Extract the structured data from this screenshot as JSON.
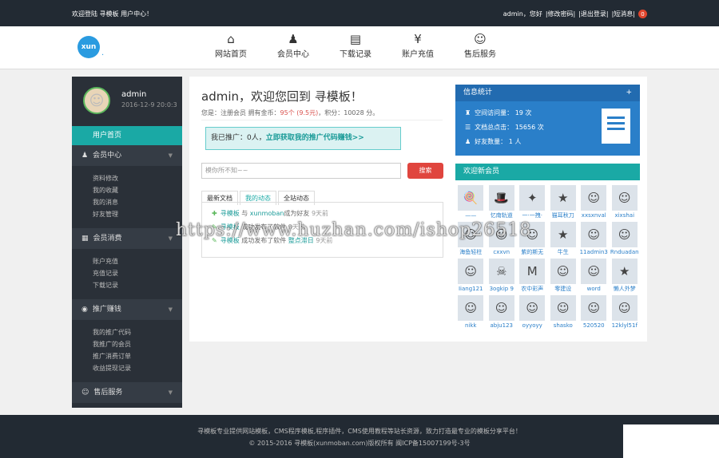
{
  "topbar": {
    "welcome": "欢迎登陆 寻模板 用户中心！",
    "greeting": "admin，您好",
    "edit_password": "|修改密码|",
    "logout": "|退出登录|",
    "messages": "|短消息|",
    "message_count": "0"
  },
  "header": {
    "logo_text": "xun",
    "nav": [
      {
        "label": "网站首页",
        "icon": "home-icon",
        "glyph": "⌂"
      },
      {
        "label": "会员中心",
        "icon": "user-icon",
        "glyph": "♟"
      },
      {
        "label": "下载记录",
        "icon": "list-icon",
        "glyph": "▤"
      },
      {
        "label": "账户充值",
        "icon": "yen-icon",
        "glyph": "¥"
      },
      {
        "label": "售后服务",
        "icon": "smile-icon",
        "glyph": "☺"
      }
    ]
  },
  "sidebar": {
    "username": "admin",
    "login_date": "2016-12-9 20:0:3",
    "home": "用户首页",
    "sections": [
      {
        "title": "会员中心",
        "icon": "user-icon",
        "glyph": "♟",
        "items": [
          "资料修改",
          "我的收藏",
          "我的消息",
          "好友管理"
        ]
      },
      {
        "title": "会员消费",
        "icon": "table-icon",
        "glyph": "▦",
        "items": [
          "账户充值",
          "充值记录",
          "下载记录"
        ]
      },
      {
        "title": "推广赚钱",
        "icon": "coin-icon",
        "glyph": "◉",
        "items": [
          "我的推广代码",
          "我推广的会员",
          "推广消费订单",
          "收益提现记录"
        ]
      },
      {
        "title": "售后服务",
        "icon": "smile-icon",
        "glyph": "☺",
        "items": []
      }
    ]
  },
  "main": {
    "hello": "admin，欢迎您回到 寻模板！",
    "info_prefix": "您是：注册会员 拥有金币：",
    "gold": "95个 (9.5元)",
    "info_suffix": "，积分：10028 分。",
    "promo_prefix": "我已推广：0人，",
    "promo_link": "立即获取我的推广代码赚钱>>",
    "search_placeholder": "模你所不知~~",
    "search_button": "搜索",
    "tabs": [
      "最新文档",
      "我的动态",
      "全站动态"
    ],
    "feed": [
      {
        "user": "寻模板",
        "action": " 与 ",
        "target": "xunmoban",
        "tail": "成为好友",
        "time": " 9天前"
      },
      {
        "user": "寻模板",
        "action": " 成功发布了软件 ",
        "target": "",
        "tail": "",
        "time": " 9天前"
      },
      {
        "user": "寻模板",
        "action": " 成功发布了软件 ",
        "target": "整点滞日",
        "tail": "",
        "time": " 9天前"
      }
    ]
  },
  "stats": {
    "title": "信息统计",
    "plus": "+",
    "rows": [
      {
        "icon": "visit-icon",
        "glyph": "♜",
        "text": "空间访问量： 19 次"
      },
      {
        "icon": "doc-count-icon",
        "glyph": "☰",
        "text": "文档总点击： 15656 次"
      },
      {
        "icon": "friends-icon",
        "glyph": "♟",
        "text": "好友数量： 1 人"
      }
    ]
  },
  "members": {
    "title": "欢迎新会员",
    "list": [
      {
        "name": "——",
        "glyph": "🍭"
      },
      {
        "name": "忆南轨道",
        "glyph": "🎩"
      },
      {
        "name": "一·一拽·",
        "glyph": "✦"
      },
      {
        "name": "猫耳秋刀",
        "glyph": "★"
      },
      {
        "name": "xxsxnval",
        "glyph": "☺"
      },
      {
        "name": "xixshai",
        "glyph": "☺"
      },
      {
        "name": "海鱼轻柱",
        "glyph": "☺"
      },
      {
        "name": "cxxvn",
        "glyph": "☺"
      },
      {
        "name": "紫的斯无",
        "glyph": "☺"
      },
      {
        "name": "牛生",
        "glyph": "★"
      },
      {
        "name": "11admin3",
        "glyph": "☺"
      },
      {
        "name": "Rnduadan",
        "glyph": "☺"
      },
      {
        "name": "Iiang121",
        "glyph": "☺"
      },
      {
        "name": "3ogkip 9",
        "glyph": "☠"
      },
      {
        "name": "农中彩声",
        "glyph": "M"
      },
      {
        "name": "零建设",
        "glyph": "☺"
      },
      {
        "name": "word",
        "glyph": "☺"
      },
      {
        "name": "懒人外梦",
        "glyph": "★"
      },
      {
        "name": "nikk",
        "glyph": "☺"
      },
      {
        "name": "abju123",
        "glyph": "☺"
      },
      {
        "name": "oyyoyy",
        "glyph": "☺"
      },
      {
        "name": "shasko",
        "glyph": "☺"
      },
      {
        "name": "520520",
        "glyph": "☺"
      },
      {
        "name": "12klyl51f",
        "glyph": "☺"
      }
    ]
  },
  "footer": {
    "line1": "寻模板专业提供网站模板，CMS程序模板,程序插件，CMS使用教程等站长资源，致力打造最专业的模板分享平台！",
    "line2": "© 2015-2016 寻模板(xunmoban.com)版权所有  闽ICP备15007199号-3号"
  },
  "watermark": "https://www.huzhan.com/ishop26518"
}
